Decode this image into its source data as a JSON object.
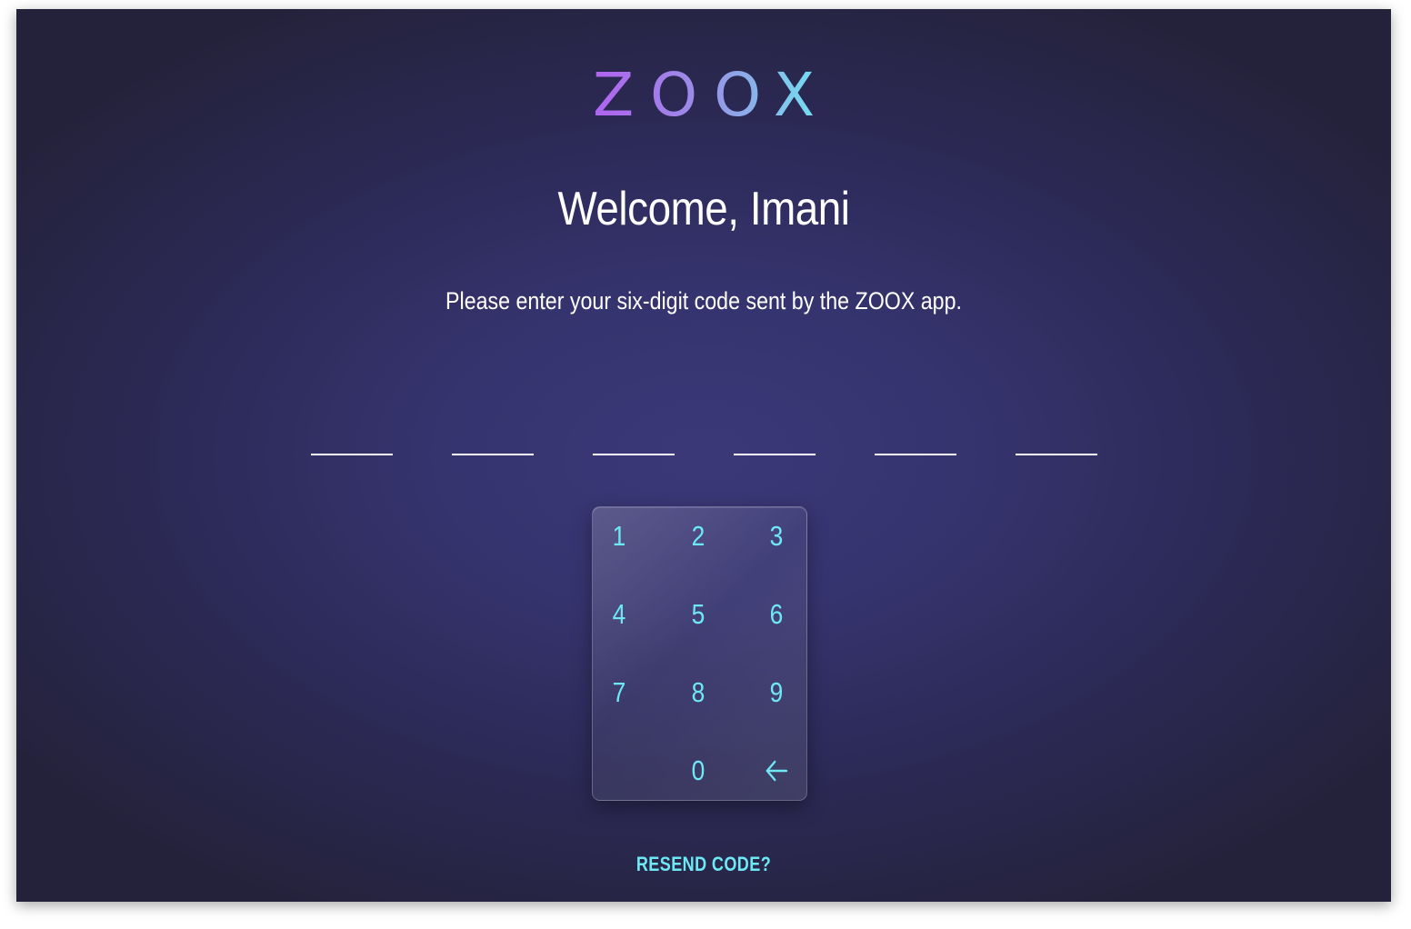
{
  "logo": {
    "text": "ZOOX"
  },
  "header": {
    "welcome": "Welcome, Imani"
  },
  "instructions": {
    "text": "Please enter your six-digit code sent by the ZOOX app."
  },
  "code_input": {
    "slots": [
      "",
      "",
      "",
      "",
      "",
      ""
    ]
  },
  "keypad": {
    "keys": [
      "1",
      "2",
      "3",
      "4",
      "5",
      "6",
      "7",
      "8",
      "9",
      "0"
    ],
    "backspace_icon": "arrow-left-icon"
  },
  "resend": {
    "label": "RESEND CODE?"
  },
  "colors": {
    "accent": "#6ee8f4",
    "logo_gradient_start": "#b45cf0",
    "logo_gradient_end": "#6fe8f2",
    "background": "#36346f"
  }
}
